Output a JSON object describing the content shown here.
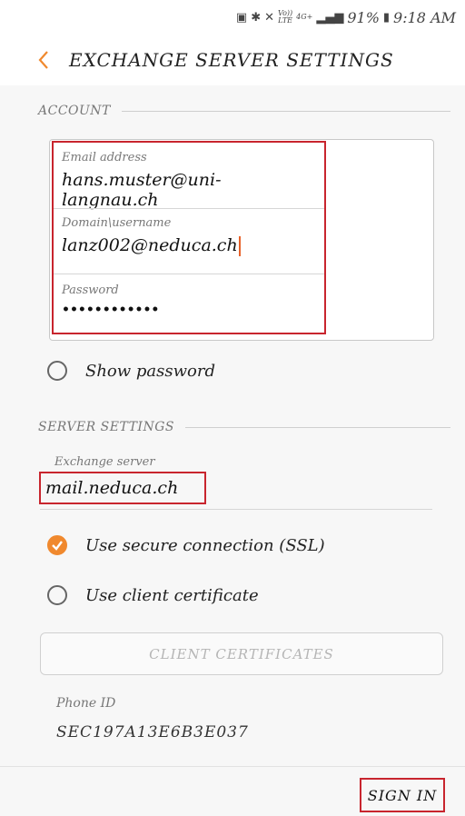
{
  "status_bar": {
    "indicators": [
      "sim-icon",
      "bluetooth-icon",
      "mute-icon",
      "volte-icon",
      "4g-icon",
      "signal-icon"
    ],
    "volte_text": "Vo))\nLTE",
    "net_text": "4G+",
    "battery_text": "91%",
    "time": "9:18 AM"
  },
  "header": {
    "title": "EXCHANGE SERVER SETTINGS"
  },
  "account": {
    "section_title": "ACCOUNT",
    "email": {
      "label": "Email address",
      "value": "hans.muster@uni-langnau.ch"
    },
    "domain": {
      "label": "Domain\\username",
      "value": "lanz002@neduca.ch"
    },
    "password": {
      "label": "Password",
      "value": "••••••••••••"
    },
    "show_password_label": "Show password"
  },
  "server": {
    "section_title": "SERVER SETTINGS",
    "exchange_label": "Exchange server",
    "exchange_value": "mail.neduca.ch",
    "ssl_label": "Use secure connection (SSL)",
    "ssl_checked": true,
    "client_cert_label": "Use client certificate",
    "client_cert_checked": false,
    "client_certificates_button": "CLIENT CERTIFICATES"
  },
  "phone": {
    "label": "Phone ID",
    "value": "SEC197A13E6B3E037"
  },
  "footer": {
    "sign_in_label": "SIGN IN"
  },
  "colors": {
    "accent": "#f0892e",
    "highlight": "#c8252e"
  }
}
